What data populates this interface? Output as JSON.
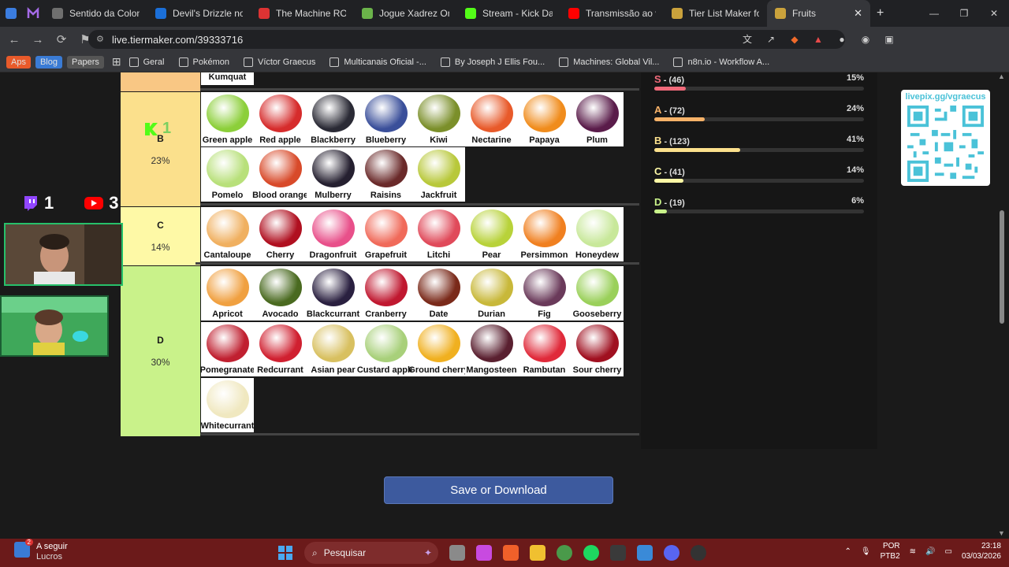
{
  "tabs": [
    {
      "label": "Sentido da Coloniza",
      "color": "#6f6f6f"
    },
    {
      "label": "Devil's Drizzle no St",
      "color": "#1b6fd8"
    },
    {
      "label": "The Machine ROM",
      "color": "#d33"
    },
    {
      "label": "Jogue Xadrez Online",
      "color": "#6bb34a"
    },
    {
      "label": "Stream - Kick Da",
      "color": "#53fc18"
    },
    {
      "label": "Transmissão ao vivo",
      "color": "#ff0000"
    },
    {
      "label": "Tier List Maker for E",
      "color": "#caa23c"
    },
    {
      "label": "Fruits",
      "color": "#caa23c"
    }
  ],
  "new_tab_symbol": "+",
  "address": {
    "url": "live.tiermaker.com/39333716"
  },
  "bookmarks": {
    "pills": [
      {
        "label": "Aps",
        "bg": "#e85a2a"
      },
      {
        "label": "Blog",
        "bg": "#3a7bd5"
      },
      {
        "label": "Papers",
        "bg": "#555"
      }
    ],
    "items": [
      "Geral",
      "Pokémon",
      "Víctor Graecus",
      "Multicanais Oficial -...",
      "By Joseph J Ellis Fou...",
      "Machines: Global Vil...",
      "n8n.io - Workflow A..."
    ]
  },
  "tiers": {
    "partial_top": {
      "item": "Kumquat",
      "color": "#f9c784"
    },
    "B": {
      "label": "B",
      "pct": "23%",
      "color": "#fbe08c",
      "items": [
        "Green apple",
        "Red apple",
        "Blackberry",
        "Blueberry",
        "Kiwi",
        "Nectarine",
        "Papaya",
        "Plum",
        "Pomelo",
        "Blood orange",
        "Mulberry",
        "Raisins",
        "Jackfruit"
      ]
    },
    "C": {
      "label": "C",
      "pct": "14%",
      "color": "#fef9a6",
      "items": [
        "Cantaloupe",
        "Cherry",
        "Dragonfruit",
        "Grapefruit",
        "Litchi",
        "Pear",
        "Persimmon",
        "Honeydew"
      ]
    },
    "D": {
      "label": "D",
      "pct": "30%",
      "color": "#c9f28a",
      "items": [
        "Apricot",
        "Avocado",
        "Blackcurrant",
        "Cranberry",
        "Date",
        "Durian",
        "Fig",
        "Gooseberry",
        "Pomegranate",
        "Redcurrant",
        "Asian pear",
        "Custard apple",
        "Ground cherry",
        "Mangosteen",
        "Rambutan",
        "Sour cherry",
        "Whitecurrant"
      ]
    }
  },
  "fruit_colors": {
    "Kumquat": "#f0a020",
    "Green apple": "#8ccf3a",
    "Red apple": "#d62c2c",
    "Blackberry": "#2a2a35",
    "Blueberry": "#3a4f9a",
    "Kiwi": "#7b8f2a",
    "Nectarine": "#e85a2a",
    "Papaya": "#f08c1c",
    "Plum": "#5a1c4a",
    "Pomelo": "#b8e07a",
    "Blood orange": "#d84a2a",
    "Mulberry": "#252030",
    "Raisins": "#6a2a2a",
    "Jackfruit": "#b8c83a",
    "Cantaloupe": "#f0b060",
    "Cherry": "#b01020",
    "Dragonfruit": "#e8508a",
    "Grapefruit": "#f06a5a",
    "Litchi": "#e04a5a",
    "Pear": "#b8d23a",
    "Persimmon": "#f08020",
    "Honeydew": "#c8e89a",
    "Apricot": "#f0a040",
    "Avocado": "#4a6a20",
    "Blackcurrant": "#2a2040",
    "Cranberry": "#c01830",
    "Date": "#7a2a1a",
    "Durian": "#c8b83a",
    "Fig": "#6a3a5a",
    "Gooseberry": "#9ad05a",
    "Pomegranate": "#c02030",
    "Redcurrant": "#d02030",
    "Asian pear": "#d8c060",
    "Custard apple": "#a8d07a",
    "Ground cherry": "#f0b020",
    "Mangosteen": "#5a2030",
    "Rambutan": "#e02a3a",
    "Sour cherry": "#a01020",
    "Whitecurrant": "#f0e8c0"
  },
  "stats": [
    {
      "tier": "S",
      "count": "- (46)",
      "pct": "15%",
      "fraction": 0.15,
      "color": "#f06a7a"
    },
    {
      "tier": "A",
      "count": "- (72)",
      "pct": "24%",
      "fraction": 0.24,
      "color": "#f7b268"
    },
    {
      "tier": "B",
      "count": "- (123)",
      "pct": "41%",
      "fraction": 0.41,
      "color": "#fbe08c"
    },
    {
      "tier": "C",
      "count": "- (41)",
      "pct": "14%",
      "fraction": 0.14,
      "color": "#fef9a6"
    },
    {
      "tier": "D",
      "count": "- (19)",
      "pct": "6%",
      "fraction": 0.06,
      "color": "#c9f28a"
    }
  ],
  "save_button": {
    "label": "Save or Download"
  },
  "qr": {
    "text": "livepix.gg/vgraecus"
  },
  "overlay": {
    "twitch_count": "1",
    "youtube_count": "3",
    "kick_count": "1"
  },
  "taskbar": {
    "news_title": "A seguir",
    "news_sub": "Lucros",
    "news_badge": "2",
    "search_placeholder": "Pesquisar",
    "lang": "POR",
    "layout": "PTB2",
    "time": "23:18",
    "date": "03/03/2026"
  }
}
